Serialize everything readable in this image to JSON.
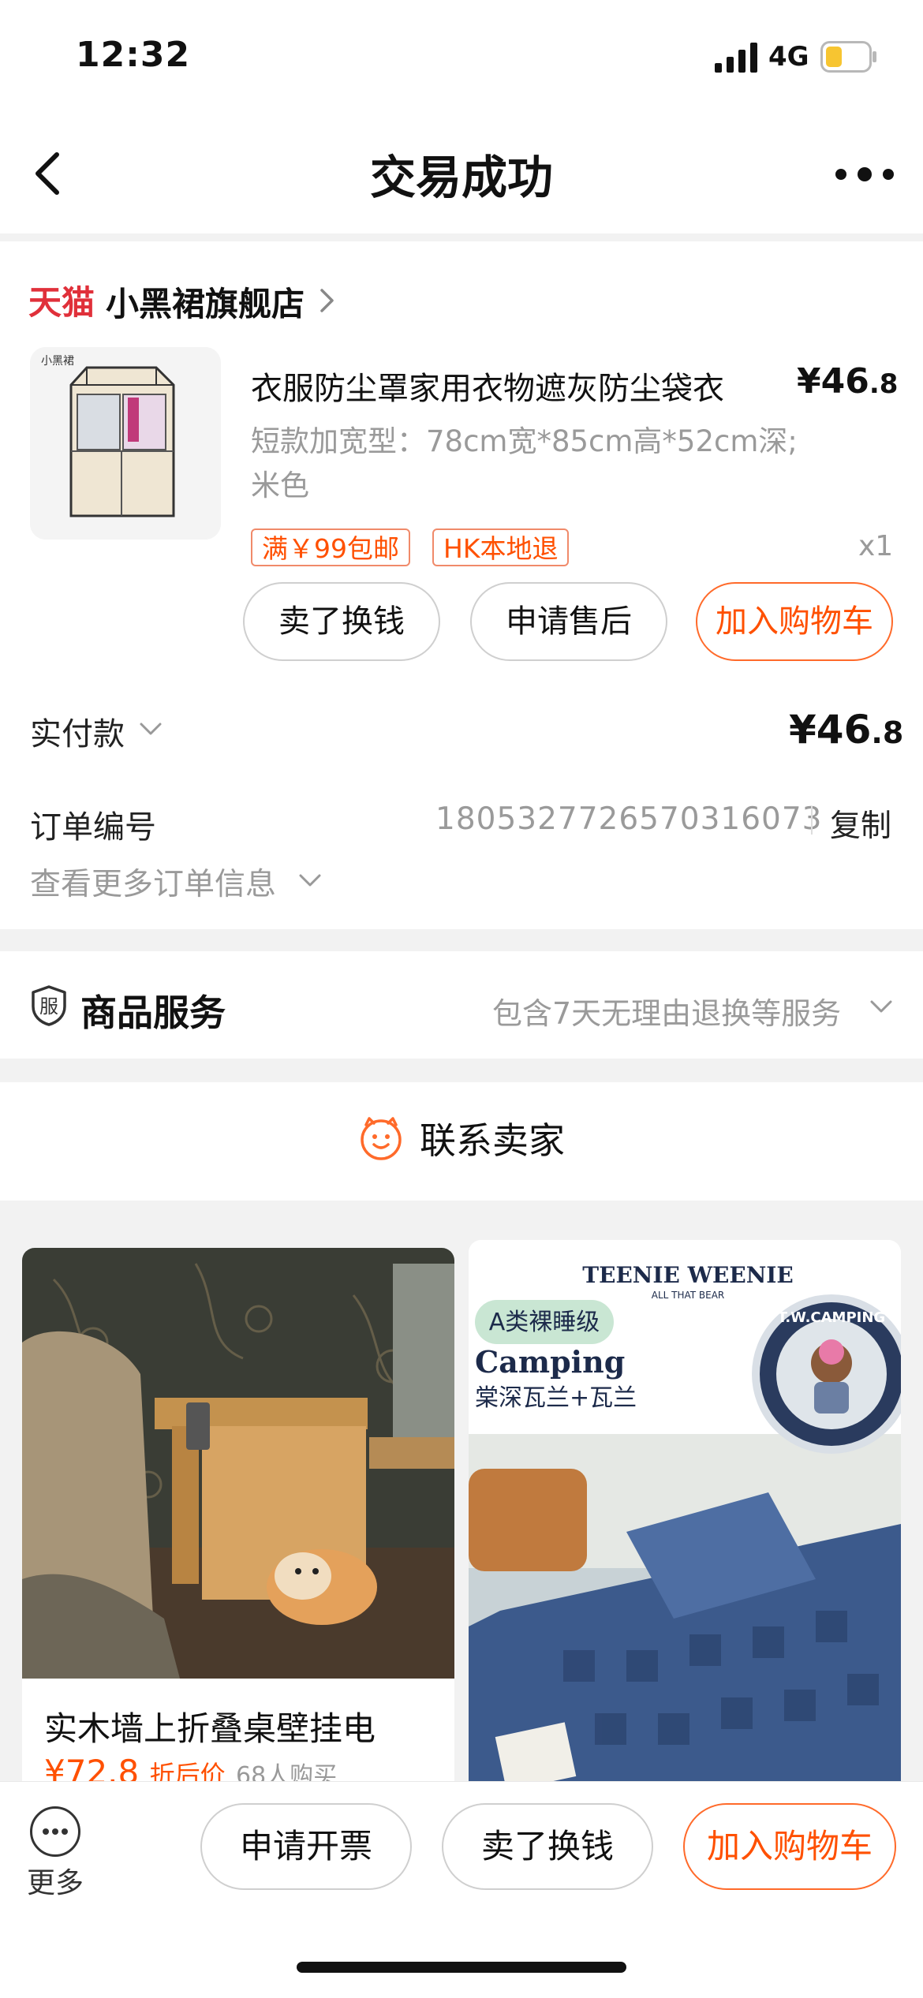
{
  "status": {
    "time": "12:32",
    "network": "4G",
    "battery_color": "#f7c531"
  },
  "nav": {
    "title": "交易成功"
  },
  "shop": {
    "brand": "天猫",
    "name": "小黑裙旗舰店"
  },
  "product": {
    "title": "衣服防尘罩家用衣物遮灰防尘袋衣",
    "price_symbol": "¥",
    "price_int": "46",
    "price_dec": ".8",
    "sku": "短款加宽型：78cm宽*85cm高*52cm深;米色",
    "tags": [
      "满￥99包邮",
      "HK本地退"
    ],
    "quantity": "x1",
    "thumb_brand": "小黑裙",
    "actions": [
      "卖了换钱",
      "申请售后",
      "加入购物车"
    ]
  },
  "payment": {
    "label": "实付款",
    "symbol": "¥",
    "amount_int": "46",
    "amount_dec": ".8"
  },
  "order": {
    "label": "订单编号",
    "number": "1805327726570316073",
    "copy_label": "复制",
    "more_info": "查看更多订单信息"
  },
  "service": {
    "icon_char": "服",
    "title": "商品服务",
    "desc": "包含7天无理由退换等服务"
  },
  "contact": {
    "label": "联系卖家"
  },
  "feed": [
    {
      "title": "实木墙上折叠桌壁挂电",
      "price": "¥72.8",
      "price_note": "折后价",
      "buyers": "68人购买"
    },
    {
      "brand": "TEENIE WEENIE",
      "brand_sub": "ALL THAT BEAR",
      "badge": "A类裸睡级",
      "heading": "Camping",
      "subheading": "棠深瓦兰+瓦兰",
      "logo_text": "T.W.CAMPING"
    }
  ],
  "bottom_bar": {
    "more_label": "更多",
    "actions": [
      "申请开票",
      "卖了换钱",
      "加入购物车"
    ]
  },
  "colors": {
    "accent": "#ff5000",
    "tmall_red": "#e0303a"
  }
}
